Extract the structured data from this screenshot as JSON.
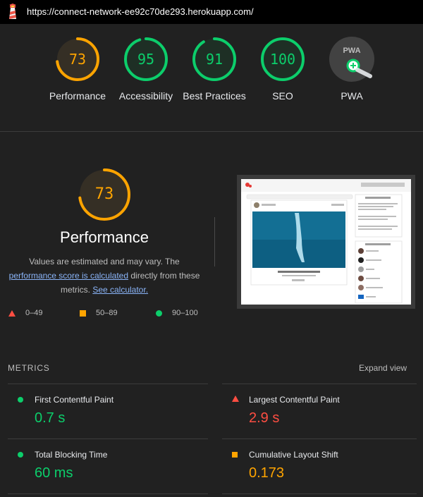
{
  "url_bar": {
    "url": "https://connect-network-ee92c70de293.herokuapp.com/",
    "icon": "lighthouse-icon"
  },
  "categories": [
    {
      "score": "73",
      "label": "Performance",
      "status": "average"
    },
    {
      "score": "95",
      "label": "Accessibility",
      "status": "pass"
    },
    {
      "score": "91",
      "label": "Best Practices",
      "status": "pass"
    },
    {
      "score": "100",
      "label": "SEO",
      "status": "pass"
    },
    {
      "score": "PWA",
      "label": "PWA",
      "status": "pwa"
    }
  ],
  "colors": {
    "pass": "#0cce6b",
    "average": "#ffa400",
    "fail": "#ff4e42",
    "bg": "#212121"
  },
  "performance": {
    "score": "73",
    "title": "Performance",
    "note_prefix": "Values are estimated and may vary. The",
    "note_link": "performance score is calculated",
    "note_mid": "directly from these metrics.",
    "note_calc": "See calculator."
  },
  "legend": [
    {
      "range": "0–49",
      "shape": "triangle"
    },
    {
      "range": "50–89",
      "shape": "square"
    },
    {
      "range": "90–100",
      "shape": "circle"
    }
  ],
  "metrics_section": {
    "title": "METRICS",
    "expand_label": "Expand view",
    "items": [
      {
        "name": "First Contentful Paint",
        "value": "0.7 s",
        "status": "pass"
      },
      {
        "name": "Largest Contentful Paint",
        "value": "2.9 s",
        "status": "fail"
      },
      {
        "name": "Total Blocking Time",
        "value": "60 ms",
        "status": "pass"
      },
      {
        "name": "Cumulative Layout Shift",
        "value": "0.173",
        "status": "average"
      }
    ]
  },
  "screenshot": {
    "search_placeholder": "Search",
    "nav": "Home · 🔍 Sign in · Signup",
    "post_caption": "Not to Post (TRASISON) v1",
    "post_sub": "Seeing a most beautiful photos of this ...",
    "sidebar_title": "Community Wall",
    "sidebar2_title": "Popular Profiles"
  }
}
